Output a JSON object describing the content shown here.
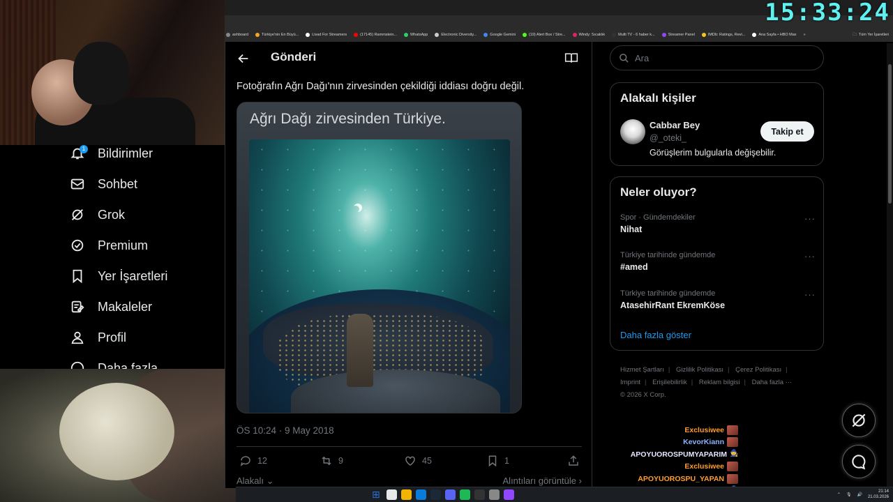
{
  "clock": "15:33:24",
  "bookmarks": [
    {
      "label": "ashboard",
      "color": "#888888"
    },
    {
      "label": "Türkiye'nin En Büyü...",
      "color": "#f5a623"
    },
    {
      "label": "Livad For Streamers",
      "color": "#ffffff"
    },
    {
      "label": "(17145) Rammstein...",
      "color": "#ff0000"
    },
    {
      "label": "WhatsApp",
      "color": "#25d366"
    },
    {
      "label": "Electronic Diversity...",
      "color": "#cccccc"
    },
    {
      "label": "Google Gemini",
      "color": "#4285f4"
    },
    {
      "label": "(19) Alert Box / Stre...",
      "color": "#53fc18"
    },
    {
      "label": "Windy: Sıcaklık",
      "color": "#e0245e"
    },
    {
      "label": "Multi TV - 6 haber k...",
      "color": "#333333"
    },
    {
      "label": "Streamer Panel",
      "color": "#9146ff"
    },
    {
      "label": "IMDb: Ratings, Revi...",
      "color": "#f5c518"
    },
    {
      "label": "Ana Sayfa • HBO Max",
      "color": "#ffffff"
    }
  ],
  "bookmarks_overflow": "»",
  "bookmarks_all": "Tüm Yer İşaretleri",
  "nav": {
    "notifications": "Bildirimler",
    "notifications_badge": "1",
    "chat": "Sohbet",
    "grok": "Grok",
    "premium": "Premium",
    "bookmarks": "Yer İşaretleri",
    "articles": "Makaleler",
    "profile": "Profil",
    "more": "Daha fazla"
  },
  "post": {
    "header_title": "Gönderi",
    "text": "Fotoğrafın Ağrı Dağı'nın zirvesinden çekildiği iddiası doğru değil.",
    "media_caption": "Ağrı Dağı zirvesinden Türkiye.",
    "timestamp": "ÖS 10:24 · 9 May 2018",
    "replies": "12",
    "reposts": "9",
    "likes": "45",
    "bookmarks": "1",
    "relevant": "Alakalı",
    "view_quotes": "Alıntıları görüntüle"
  },
  "sidebar": {
    "search_placeholder": "Ara",
    "related_title": "Alakalı kişiler",
    "person": {
      "name": "Cabbar Bey",
      "handle": "@_oteki_",
      "bio": "Görüşlerim bulgularla değişebilir.",
      "follow": "Takip et"
    },
    "trends_title": "Neler oluyor?",
    "trends": [
      {
        "category": "Spor · Gündemdekiler",
        "name": "Nihat",
        "more": "···"
      },
      {
        "category": "Türkiye tarihinde gündemde",
        "name": "#amed",
        "more": "···"
      },
      {
        "category": "Türkiye tarihinde gündemde",
        "name": "AtasehirRant EkremKöse",
        "more": "···"
      }
    ],
    "show_more": "Daha fazla göster",
    "footer": {
      "terms": "Hizmet Şartları",
      "privacy": "Gizlilik Politikası",
      "cookies": "Çerez Politikası",
      "imprint": "Imprint",
      "accessibility": "Erişilebilirlik",
      "ads": "Reklam bilgisi",
      "more": "Daha fazla ···",
      "copyright": "© 2026 X Corp."
    }
  },
  "chat": [
    {
      "user": "Exclusiwee",
      "color": "#ff9d2e",
      "emote": "red"
    },
    {
      "user": "KevorKiann",
      "color": "#8ab4ff",
      "emote": "red"
    },
    {
      "user": "APOYUOROSPUMYAPARIM",
      "color": "#e6e8ff",
      "emote": "purple"
    },
    {
      "user": "Exclusiwee",
      "color": "#ff9d2e",
      "emote": "red"
    },
    {
      "user": "APOYUOROSPU_YAPAN",
      "color": "#ff9d2e",
      "emote": "red"
    },
    {
      "user": "APOYUOROSPUMYAPARIM",
      "color": "#e6e8ff",
      "emote": "purple"
    }
  ],
  "taskbar": {
    "time": "21:14",
    "date": "21.03.2026",
    "apps": [
      "#2b6fd6",
      "#e8e8e8",
      "#f2b400",
      "#0a7bd8",
      "#1b2838",
      "#5865f2",
      "#1db954",
      "#333333",
      "#888888",
      "#9146ff"
    ]
  }
}
